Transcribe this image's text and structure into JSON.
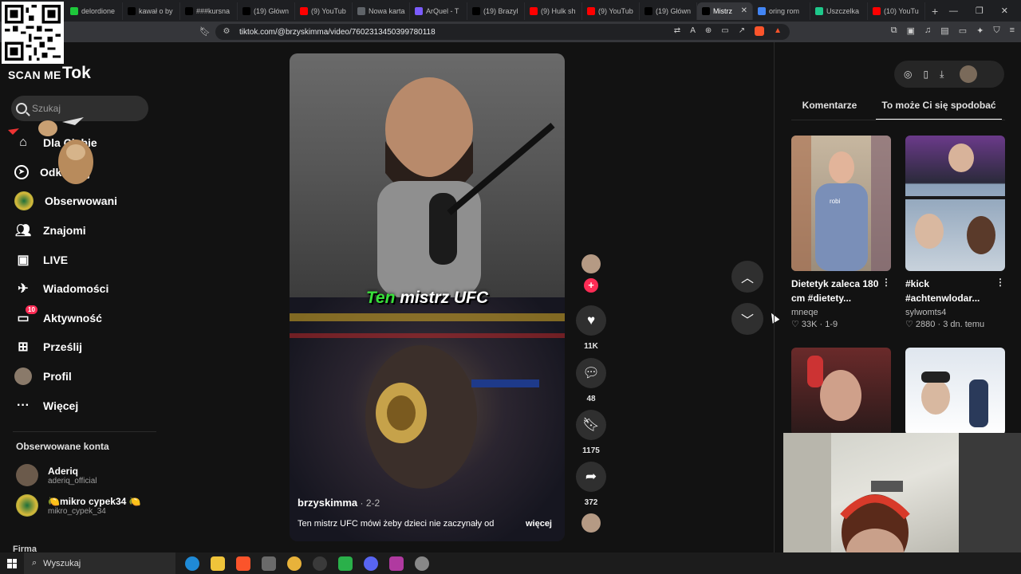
{
  "browser": {
    "tabs": [
      {
        "label": "delordione",
        "color": "#1ec83b"
      },
      {
        "label": "kawał o by",
        "color": "#000000"
      },
      {
        "label": "###kursna",
        "color": "#000000"
      },
      {
        "label": "(19) Główn",
        "color": "#000000"
      },
      {
        "label": "(9) YouTub",
        "color": "#ff0000"
      },
      {
        "label": "Nowa karta",
        "color": "#5f6368"
      },
      {
        "label": "ArQuel - T",
        "color": "#7b5cff"
      },
      {
        "label": "(19) Brazyl",
        "color": "#000000"
      },
      {
        "label": "(9) Hulk sh",
        "color": "#ff0000"
      },
      {
        "label": "(9) YouTub",
        "color": "#ff0000"
      },
      {
        "label": "(19) Główn",
        "color": "#000000"
      },
      {
        "label": "Mistrz",
        "color": "#000000",
        "active": true
      },
      {
        "label": "oring rom",
        "color": "#4285f4"
      },
      {
        "label": "Uszczelka",
        "color": "#1ec88b"
      },
      {
        "label": "(10) YouTu",
        "color": "#ff0000"
      }
    ],
    "new_tab_label": "+",
    "url": "tiktok.com/@brzyskimma/video/7602313450399780118"
  },
  "overlay": {
    "scan_me": "SCAN ME"
  },
  "tiktok": {
    "logo_fragment": "Tok",
    "search_placeholder": "Szukaj",
    "nav": [
      {
        "label": "Dla Ciebie",
        "icon": "home-icon"
      },
      {
        "label": "Odkrywaj",
        "icon": "compass-icon"
      },
      {
        "label": "Obserwowani",
        "icon": "following-avatar-icon"
      },
      {
        "label": "Znajomi",
        "icon": "friends-icon"
      },
      {
        "label": "LIVE",
        "icon": "live-icon"
      },
      {
        "label": "Wiadomości",
        "icon": "messages-icon"
      },
      {
        "label": "Aktywność",
        "icon": "activity-icon",
        "badge": "10"
      },
      {
        "label": "Prześlij",
        "icon": "upload-icon"
      },
      {
        "label": "Profil",
        "icon": "profile-avatar-icon"
      },
      {
        "label": "Więcej",
        "icon": "more-dots-icon"
      }
    ],
    "following_heading": "Obserwowane konta",
    "following": [
      {
        "name": "Aderiq",
        "handle": "aderiq_official"
      },
      {
        "name": "🍋mikro cypek34 🍋",
        "handle": "mikro_cypek_34"
      }
    ],
    "footer_label": "Firma"
  },
  "video": {
    "caption_green": "Ten",
    "caption_white": " mistrz UFC",
    "author": "brzyskimma",
    "date": " · 2-2",
    "description": "Ten mistrz UFC mówi żeby dzieci nie zaczynały od",
    "more": "więcej",
    "likes": "11K",
    "comments": "48",
    "saves": "1175",
    "shares": "372"
  },
  "right_panel": {
    "tab_comments": "Komentarze",
    "tab_you_may_like": "To może Ci się spodobać",
    "cards": [
      {
        "title": "Dietetyk zaleca 180 cm #dietety...",
        "author": "mneqe",
        "likes": "33K",
        "date": "1-9",
        "overlay_text": "robi"
      },
      {
        "title": "#kick #achtenwlodar...",
        "author": "sylwomts4",
        "likes": "2880",
        "date": "3 dn. temu"
      }
    ]
  },
  "taskbar": {
    "search_label": "Wyszukaj"
  },
  "colors": {
    "accent_pink": "#fe2c55",
    "caption_green": "#38e03a",
    "background": "#121212"
  }
}
